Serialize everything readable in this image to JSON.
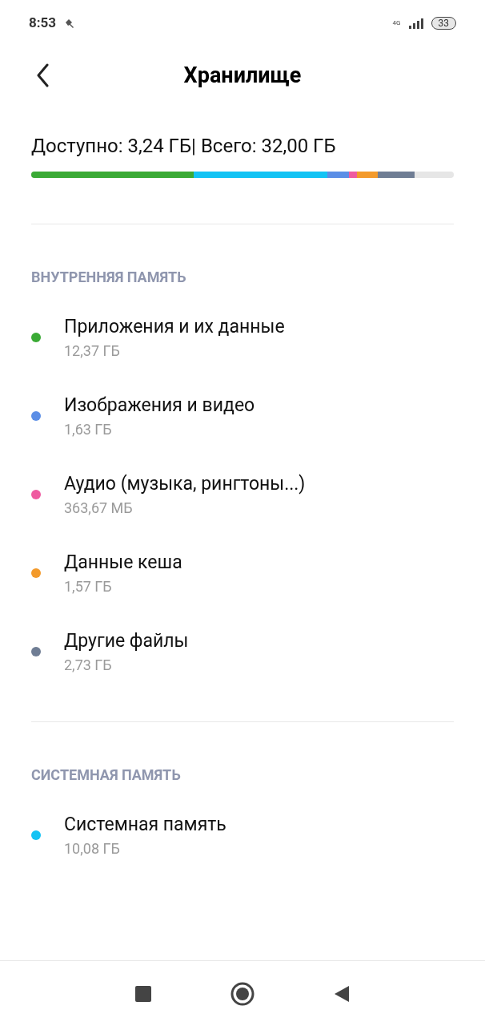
{
  "status_bar": {
    "time": "8:53",
    "network": "4G",
    "battery": "33"
  },
  "header": {
    "title": "Хранилище"
  },
  "summary": {
    "text": "Доступно: 3,24 ГБ| Всего: 32,00 ГБ"
  },
  "usage_bar": [
    {
      "color": "#3aaa35"
    },
    {
      "color": "#12c3f4"
    },
    {
      "color": "#5b8ee6"
    },
    {
      "color": "#ef5aa0"
    },
    {
      "color": "#f39a2b"
    },
    {
      "color": "#6f7d94"
    }
  ],
  "sections": [
    {
      "heading": "ВНУТРЕННЯЯ ПАМЯТЬ",
      "items": [
        {
          "name": "Приложения и их данные",
          "size": "12,37 ГБ",
          "color": "#3aaa35"
        },
        {
          "name": "Изображения и видео",
          "size": "1,63 ГБ",
          "color": "#5b8ee6"
        },
        {
          "name": "Аудио (музыка, рингтоны...)",
          "size": "363,67 МБ",
          "color": "#ef5aa0"
        },
        {
          "name": "Данные кеша",
          "size": "1,57 ГБ",
          "color": "#f39a2b"
        },
        {
          "name": "Другие файлы",
          "size": "2,73 ГБ",
          "color": "#6f7d94"
        }
      ]
    },
    {
      "heading": "СИСТЕМНАЯ ПАМЯТЬ",
      "items": [
        {
          "name": "Системная память",
          "size": "10,08 ГБ",
          "color": "#12c3f4"
        }
      ]
    }
  ]
}
